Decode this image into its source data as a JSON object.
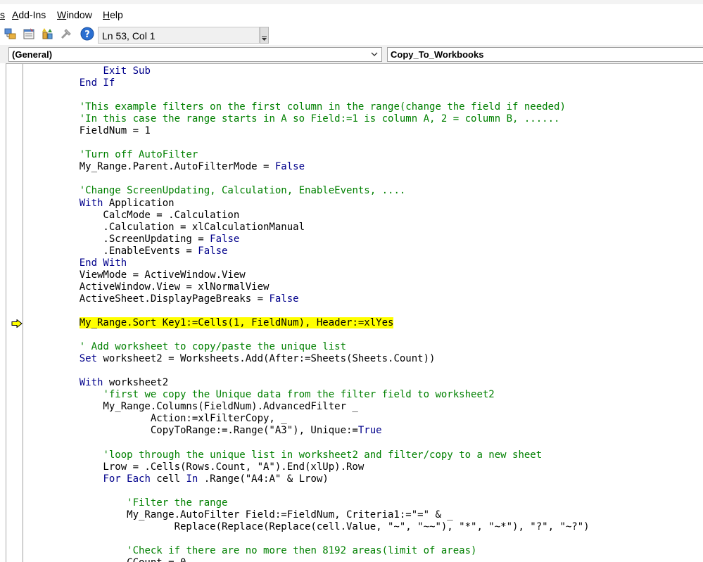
{
  "menu": {
    "items": [
      {
        "label": "s"
      },
      {
        "label": "Add-Ins"
      },
      {
        "label": "Window"
      },
      {
        "label": "Help"
      }
    ]
  },
  "toolbar": {
    "icons": [
      "project-explorer-icon",
      "properties-icon",
      "object-browser-icon",
      "toolbox-icon",
      "help-icon"
    ],
    "position_label": "Ln 53, Col 1"
  },
  "dropdowns": {
    "object": "(General)",
    "procedure": "Copy_To_Workbooks"
  },
  "code": {
    "current_line_index": 21,
    "lines": [
      [
        [
          "plain",
          "        "
        ],
        [
          "kw",
          "Exit Sub"
        ]
      ],
      [
        [
          "plain",
          "    "
        ],
        [
          "kw",
          "End If"
        ]
      ],
      [],
      [
        [
          "plain",
          "    "
        ],
        [
          "comment",
          "'This example filters on the first column in the range(change the field if needed)"
        ]
      ],
      [
        [
          "plain",
          "    "
        ],
        [
          "comment",
          "'In this case the range starts in A so Field:=1 is column A, 2 = column B, ......"
        ]
      ],
      [
        [
          "plain",
          "    FieldNum = 1"
        ]
      ],
      [],
      [
        [
          "plain",
          "    "
        ],
        [
          "comment",
          "'Turn off AutoFilter"
        ]
      ],
      [
        [
          "plain",
          "    My_Range.Parent.AutoFilterMode = "
        ],
        [
          "kw",
          "False"
        ]
      ],
      [],
      [
        [
          "plain",
          "    "
        ],
        [
          "comment",
          "'Change ScreenUpdating, Calculation, EnableEvents, ...."
        ]
      ],
      [
        [
          "plain",
          "    "
        ],
        [
          "kw",
          "With"
        ],
        [
          "plain",
          " Application"
        ]
      ],
      [
        [
          "plain",
          "        CalcMode = .Calculation"
        ]
      ],
      [
        [
          "plain",
          "        .Calculation = xlCalculationManual"
        ]
      ],
      [
        [
          "plain",
          "        .ScreenUpdating = "
        ],
        [
          "kw",
          "False"
        ]
      ],
      [
        [
          "plain",
          "        .EnableEvents = "
        ],
        [
          "kw",
          "False"
        ]
      ],
      [
        [
          "plain",
          "    "
        ],
        [
          "kw",
          "End With"
        ]
      ],
      [
        [
          "plain",
          "    ViewMode = ActiveWindow.View"
        ]
      ],
      [
        [
          "plain",
          "    ActiveWindow.View = xlNormalView"
        ]
      ],
      [
        [
          "plain",
          "    ActiveSheet.DisplayPageBreaks = "
        ],
        [
          "kw",
          "False"
        ]
      ],
      [],
      [
        [
          "plain",
          "    "
        ],
        [
          "hl",
          "My_Range.Sort Key1:=Cells(1, FieldNum), Header:=xlYes"
        ]
      ],
      [],
      [
        [
          "plain",
          "    "
        ],
        [
          "comment",
          "' Add worksheet to copy/paste the unique list"
        ]
      ],
      [
        [
          "plain",
          "    "
        ],
        [
          "kw",
          "Set"
        ],
        [
          "plain",
          " worksheet2 = Worksheets.Add(After:=Sheets(Sheets.Count))"
        ]
      ],
      [],
      [
        [
          "plain",
          "    "
        ],
        [
          "kw",
          "With"
        ],
        [
          "plain",
          " worksheet2"
        ]
      ],
      [
        [
          "plain",
          "        "
        ],
        [
          "comment",
          "'first we copy the Unique data from the filter field to worksheet2"
        ]
      ],
      [
        [
          "plain",
          "        My_Range.Columns(FieldNum).AdvancedFilter _"
        ]
      ],
      [
        [
          "plain",
          "                Action:=xlFilterCopy, _"
        ]
      ],
      [
        [
          "plain",
          "                CopyToRange:=.Range(\"A3\"), Unique:="
        ],
        [
          "kw",
          "True"
        ]
      ],
      [],
      [
        [
          "plain",
          "        "
        ],
        [
          "comment",
          "'loop through the unique list in worksheet2 and filter/copy to a new sheet"
        ]
      ],
      [
        [
          "plain",
          "        Lrow = .Cells(Rows.Count, \"A\").End(xlUp).Row"
        ]
      ],
      [
        [
          "plain",
          "        "
        ],
        [
          "kw",
          "For Each"
        ],
        [
          "plain",
          " cell "
        ],
        [
          "kw",
          "In"
        ],
        [
          "plain",
          " .Range(\"A4:A\" & Lrow)"
        ]
      ],
      [],
      [
        [
          "plain",
          "            "
        ],
        [
          "comment",
          "'Filter the range"
        ]
      ],
      [
        [
          "plain",
          "            My_Range.AutoFilter Field:=FieldNum, Criteria1:=\"=\" & _"
        ]
      ],
      [
        [
          "plain",
          "                    Replace(Replace(Replace(cell.Value, \"~\", \"~~\"), \"*\", \"~*\"), \"?\", \"~?\")"
        ]
      ],
      [],
      [
        [
          "plain",
          "            "
        ],
        [
          "comment",
          "'Check if there are no more then 8192 areas(limit of areas)"
        ]
      ],
      [
        [
          "plain",
          "            CCount = 0"
        ]
      ]
    ]
  }
}
